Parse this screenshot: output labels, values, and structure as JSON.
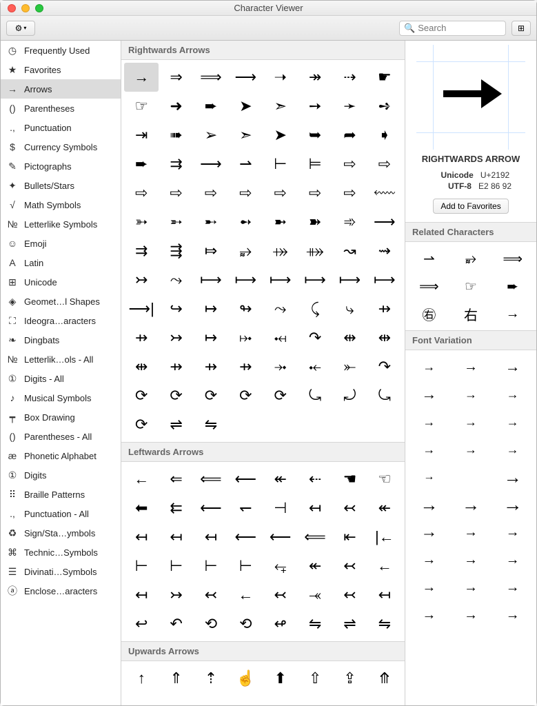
{
  "window": {
    "title": "Character Viewer"
  },
  "search": {
    "placeholder": "Search"
  },
  "sidebar": {
    "items": [
      {
        "icon": "◷",
        "label": "Frequently Used"
      },
      {
        "icon": "★",
        "label": "Favorites"
      },
      {
        "icon": "→",
        "label": "Arrows",
        "selected": true
      },
      {
        "icon": "()",
        "label": "Parentheses"
      },
      {
        "icon": ".,",
        "label": "Punctuation"
      },
      {
        "icon": "$",
        "label": "Currency Symbols"
      },
      {
        "icon": "✎",
        "label": "Pictographs"
      },
      {
        "icon": "✦",
        "label": "Bullets/Stars"
      },
      {
        "icon": "√",
        "label": "Math Symbols"
      },
      {
        "icon": "№",
        "label": "Letterlike Symbols"
      },
      {
        "icon": "☺",
        "label": "Emoji"
      },
      {
        "icon": "A",
        "label": "Latin"
      },
      {
        "icon": "⊞",
        "label": "Unicode"
      },
      {
        "icon": "◈",
        "label": "Geomet…l Shapes"
      },
      {
        "icon": "⛶",
        "label": "Ideogra…aracters"
      },
      {
        "icon": "❧",
        "label": "Dingbats"
      },
      {
        "icon": "№",
        "label": "Letterlik…ols - All"
      },
      {
        "icon": "①",
        "label": "Digits - All"
      },
      {
        "icon": "♪",
        "label": "Musical Symbols"
      },
      {
        "icon": "┯",
        "label": "Box Drawing"
      },
      {
        "icon": "()",
        "label": "Parentheses - All"
      },
      {
        "icon": "æ",
        "label": "Phonetic Alphabet"
      },
      {
        "icon": "①",
        "label": "Digits"
      },
      {
        "icon": "⠿",
        "label": "Braille Patterns"
      },
      {
        "icon": ".,",
        "label": "Punctuation - All"
      },
      {
        "icon": "♻",
        "label": "Sign/Sta…ymbols"
      },
      {
        "icon": "⌘",
        "label": "Technic…Symbols"
      },
      {
        "icon": "☰",
        "label": "Divinati…Symbols"
      },
      {
        "icon": "ⓐ",
        "label": "Enclose…aracters"
      }
    ]
  },
  "sections": [
    {
      "title": "Rightwards Arrows",
      "chars": [
        "→",
        "⇒",
        "⟹",
        "⟶",
        "➝",
        "↠",
        "⇢",
        "☛",
        "☞",
        "➜",
        "➨",
        "➤",
        "➣",
        "➙",
        "➛",
        "➺",
        "⇥",
        "➠",
        "➢",
        "➣",
        "➤",
        "➥",
        "➦",
        "➧",
        "➨",
        "⇉",
        "⟶",
        "⇀",
        "⊢",
        "⊨",
        "⇨",
        "⇨",
        "⇨",
        "⇨",
        "⇨",
        "⇨",
        "⇨",
        "⇨",
        "⇨",
        "⬳",
        "➳",
        "➵",
        "➸",
        "➻",
        "➼",
        "➽",
        "➾",
        "⟶",
        "⇉",
        "⇶",
        "⤇",
        "⥵",
        "⤀",
        "⤁",
        "↝",
        "⇝",
        "↣",
        "⤳",
        "⟼",
        "⟼",
        "⟼",
        "⟼",
        "⟼",
        "⟼",
        "⟶|",
        "↪",
        "↦",
        "↬",
        "⤳",
        "⤹",
        "⤷",
        "⇸",
        "⇸",
        "↣",
        "↦",
        "⤠",
        "⤟",
        "↷",
        "⇹",
        "⇹",
        "⇹",
        "⇸",
        "⇸",
        "⇸",
        "⤞",
        "⤝",
        "⤜",
        "↷",
        "⟳",
        "⟳",
        "⟳",
        "⟳",
        "⟳",
        "⤿",
        "⤾",
        "⤿",
        "⟳",
        "⇌",
        "⇋"
      ]
    },
    {
      "title": "Leftwards Arrows",
      "chars": [
        "←",
        "⇐",
        "⟸",
        "⟵",
        "↞",
        "⇠",
        "☚",
        "☜",
        "⬅",
        "⇇",
        "⟵",
        "↽",
        "⊣",
        "↤",
        "↢",
        "↞",
        "↤",
        "↤",
        "↤",
        "⟵",
        "⟵",
        "⟸",
        "⇤",
        "|←",
        "⊢",
        "⊢",
        "⊢",
        "⊢",
        "⥆",
        "↞",
        "↢",
        "←",
        "↤",
        "↣",
        "↢",
        "←",
        "↢",
        "⤛",
        "↢",
        "↤",
        "↩",
        "↶",
        "⟲",
        "⟲",
        "↫",
        "⇋",
        "⇌",
        "⇋"
      ]
    },
    {
      "title": "Upwards Arrows",
      "chars": [
        "↑",
        "⇑",
        "⇡",
        "☝",
        "⬆",
        "⇧",
        "⇪",
        "⤊"
      ]
    }
  ],
  "inspector": {
    "char": "➡",
    "name": "RIGHTWARDS ARROW",
    "meta": [
      {
        "k": "Unicode",
        "v": "U+2192"
      },
      {
        "k": "UTF-8",
        "v": "E2 86 92"
      }
    ],
    "add_fav": "Add to Favorites",
    "related_title": "Related Characters",
    "related": [
      "⇀",
      "⥵",
      "⟹",
      "⟹",
      "☞",
      "➨",
      "㊨",
      "右",
      "→"
    ],
    "fontvar_title": "Font Variation",
    "fontvars": [
      "→",
      "→",
      "→",
      "→",
      "→",
      "→",
      "→",
      "→",
      "→",
      "→",
      "→",
      "→",
      "→",
      "",
      "→",
      "→",
      "→",
      "→",
      "→",
      "→",
      "→",
      "→",
      "→",
      "→",
      "→",
      "→",
      "→",
      "→",
      "→",
      "→"
    ]
  }
}
